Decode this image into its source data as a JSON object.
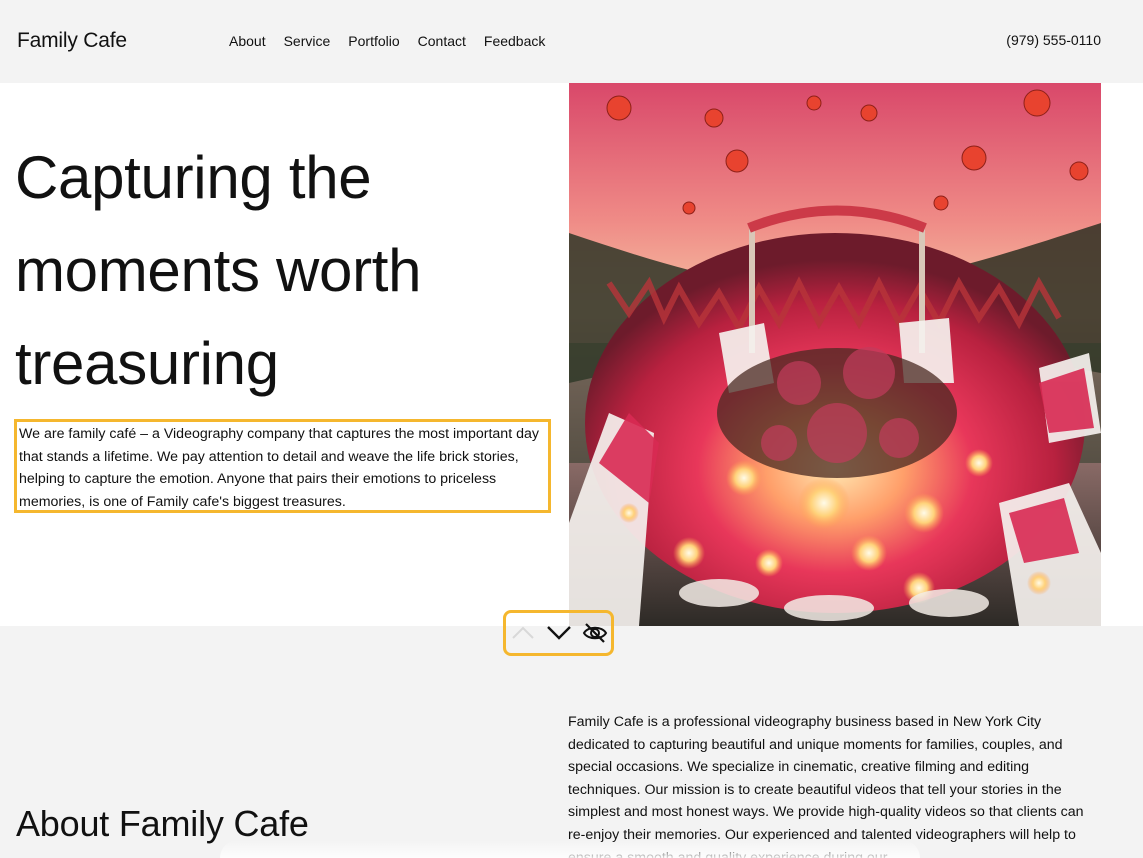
{
  "header": {
    "logo": "Family Cafe",
    "nav": [
      "About",
      "Service",
      "Portfolio",
      "Contact",
      "Feedback"
    ],
    "phone": "(979) 555-0110"
  },
  "hero": {
    "title": "Capturing the moments worth treasuring",
    "text": "We are family café – a Videography company that captures the most important day that stands a lifetime. We pay attention to detail and weave the life brick stories, helping to capture the emotion. Anyone that pairs their emotions to priceless memories, is one of Family cafe's biggest treasures."
  },
  "scroll_controls": {
    "icons": [
      "chevron-up-icon",
      "chevron-down-icon",
      "eye-off-icon"
    ]
  },
  "about": {
    "title": "About Family Cafe",
    "text": "Family Cafe is a professional videography business based in New York City dedicated to capturing beautiful and unique moments for families, couples, and special occasions. We specialize in cinematic, creative filming and editing techniques. Our mission is to create beautiful videos that tell your stories in the simplest and most honest ways. We provide high-quality videos so that clients can re-enjoy their memories. Our experienced and talented videographers will help to ensure a smooth and quality experience during our"
  },
  "colors": {
    "accent_outline": "#f5b72e",
    "page_bg": "#f3f3f3",
    "hero_bg": "#ffffff"
  }
}
